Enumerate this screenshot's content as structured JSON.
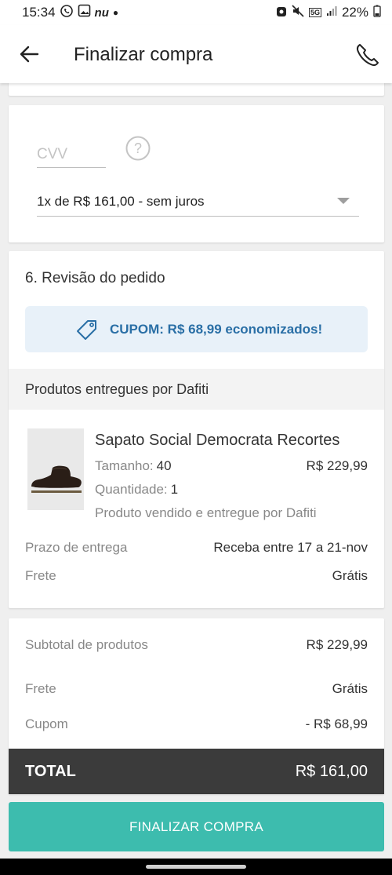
{
  "status_bar": {
    "time": "15:34",
    "carrier_text": "nu",
    "battery": "22%",
    "network": "5G"
  },
  "header": {
    "title": "Finalizar compra",
    "back_icon": "arrow-left-icon",
    "phone_icon": "phone-icon"
  },
  "payment": {
    "cvv_placeholder": "CVV",
    "cvv_value": "",
    "installments_selected": "1x de R$ 161,00 - sem juros"
  },
  "review": {
    "section_title": "6. Revisão do pedido",
    "coupon_text": "CUPOM: R$ 68,99 economizados!",
    "seller_strip": "Produtos entregues por Dafiti",
    "product": {
      "name": "Sapato Social Democrata Recortes",
      "size_label": "Tamanho:",
      "size_value": "40",
      "quantity_label": "Quantidade:",
      "quantity_value": "1",
      "price": "R$ 229,99",
      "seller_note": "Produto vendido e entregue por Dafiti"
    },
    "delivery_label": "Prazo de entrega",
    "delivery_value": "Receba entre 17 a 21-nov",
    "shipping_label": "Frete",
    "shipping_value": "Grátis"
  },
  "summary": {
    "subtotal_label": "Subtotal de produtos",
    "subtotal_value": "R$ 229,99",
    "frete_label": "Frete",
    "frete_value": "Grátis",
    "cupom_label": "Cupom",
    "cupom_value": "- R$ 68,99",
    "total_label": "TOTAL",
    "total_value": "R$ 161,00"
  },
  "actions": {
    "finalize_label": "FINALIZAR COMPRA"
  },
  "colors": {
    "accent_teal": "#3dbcae",
    "coupon_blue": "#2a6fa6",
    "coupon_bg": "#e8f1f9",
    "total_bar": "#3b3b3b"
  }
}
